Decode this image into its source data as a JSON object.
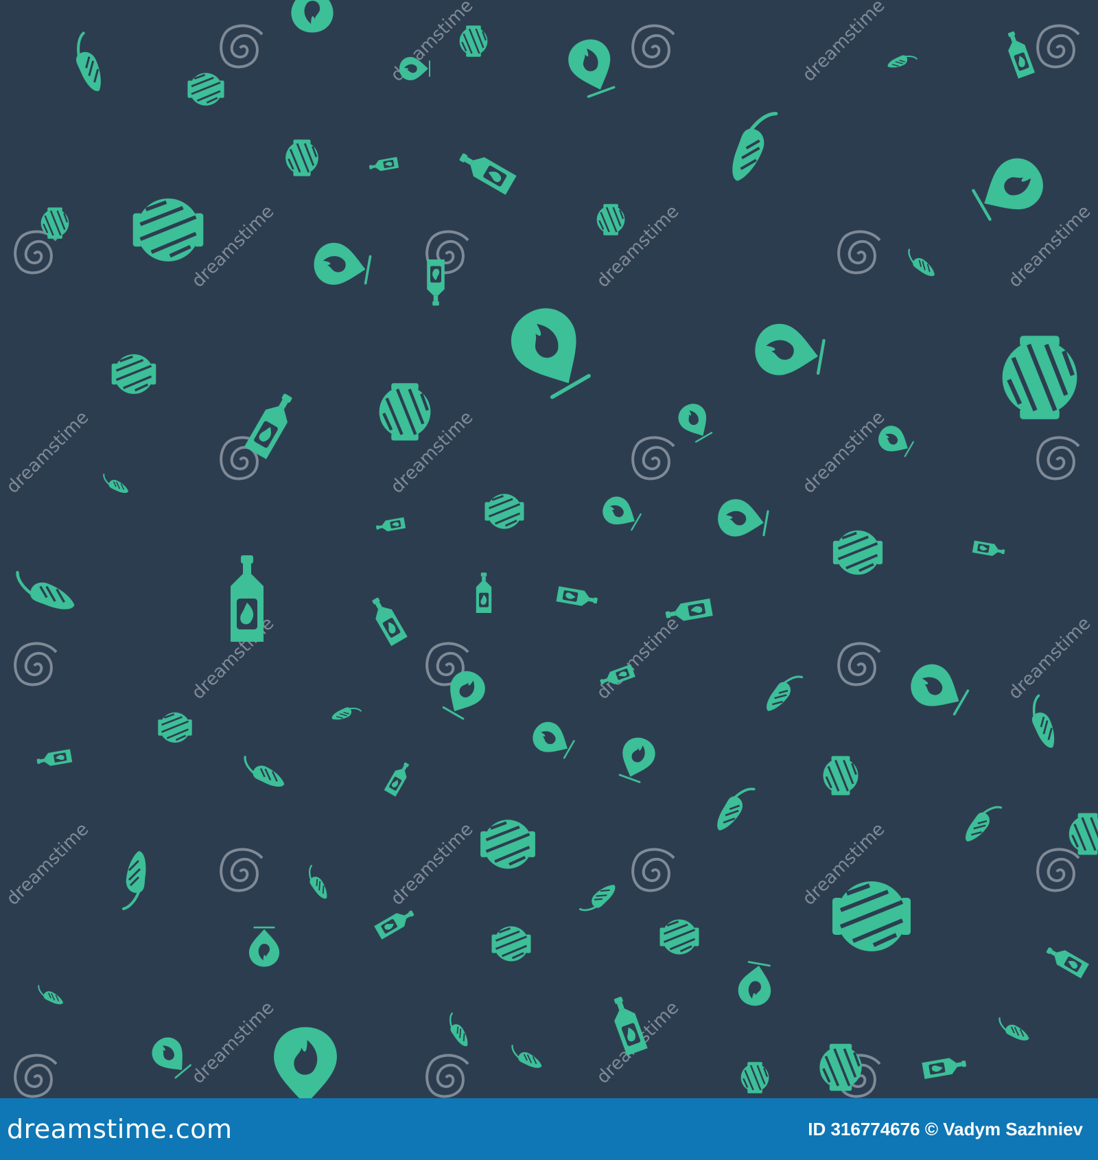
{
  "colors": {
    "background": "#2d3d50",
    "icon_fill": "#3dbf97",
    "icon_cutout": "#2d3d50",
    "watermark": "#7f8a96",
    "footer": "#0f77b5",
    "footer_text": "#ffffff"
  },
  "pattern": {
    "icons": [
      "chili-pepper-icon",
      "barbecue-grill-icon",
      "hot-sauce-bottle-icon",
      "fire-location-pin-icon"
    ]
  },
  "watermark": {
    "text": "dreamstime"
  },
  "footer": {
    "logo": "dreamstime.com",
    "id_label": "ID 316774676",
    "copyright": "©",
    "author": "Vadym Sazhniev"
  }
}
